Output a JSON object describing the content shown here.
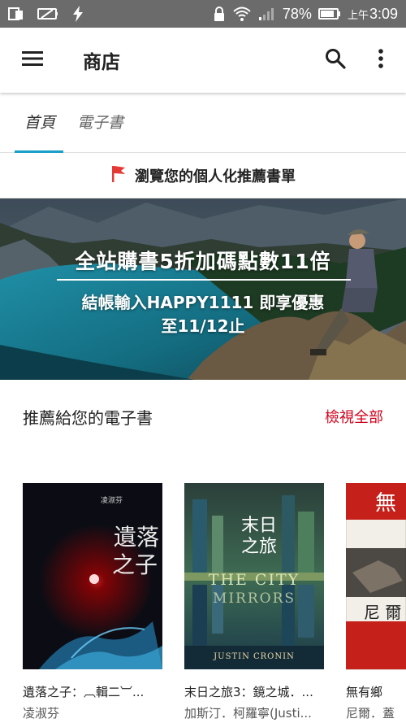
{
  "status_bar": {
    "battery_percent": "78%",
    "time_prefix": "上午",
    "time": "3:09",
    "icons": [
      "screen-mirror-icon",
      "battery-saver-icon",
      "flash-icon",
      "lock-icon",
      "wifi-icon",
      "signal-icon",
      "battery-icon"
    ]
  },
  "app_bar": {
    "title": "商店",
    "icons": [
      "menu-icon",
      "search-icon",
      "more-vert-icon"
    ]
  },
  "tabs": [
    {
      "label": "首頁",
      "active": true
    },
    {
      "label": "電子書",
      "active": false
    }
  ],
  "personalized": {
    "label": "瀏覽您的個人化推薦書單",
    "icon": "flag-icon",
    "icon_color": "#e53935"
  },
  "banner": {
    "line1": "全站購書5折加碼點數11倍",
    "line2": "結帳輸入HAPPY1111 即享優惠",
    "line3": "至11/12止"
  },
  "section": {
    "title": "推薦給您的電子書",
    "view_all": "檢視全部"
  },
  "books": [
    {
      "title": "遺落之子：︹輯二︺...",
      "author": "凌淑芬",
      "cover_title_line1": "遺落",
      "cover_title_line2": "之子",
      "cover_small": "凌淑芬"
    },
    {
      "title": "末日之旅3：鏡之城．...",
      "author": "加斯汀．柯羅寧(Justi...",
      "cover_title_line1": "末日",
      "cover_title_line2": "之旅",
      "cover_en": "THE CITY",
      "cover_en2": "MIRRORS",
      "cover_author_en": "JUSTIN CRONIN"
    },
    {
      "title": "無有鄉",
      "author": "尼爾．蓋",
      "cover_title": "無",
      "cover_author": "尼 爾"
    }
  ],
  "colors": {
    "status_bar_bg": "#6b6b6b",
    "tab_accent": "#1a9fc9",
    "view_all": "#d0021b"
  }
}
